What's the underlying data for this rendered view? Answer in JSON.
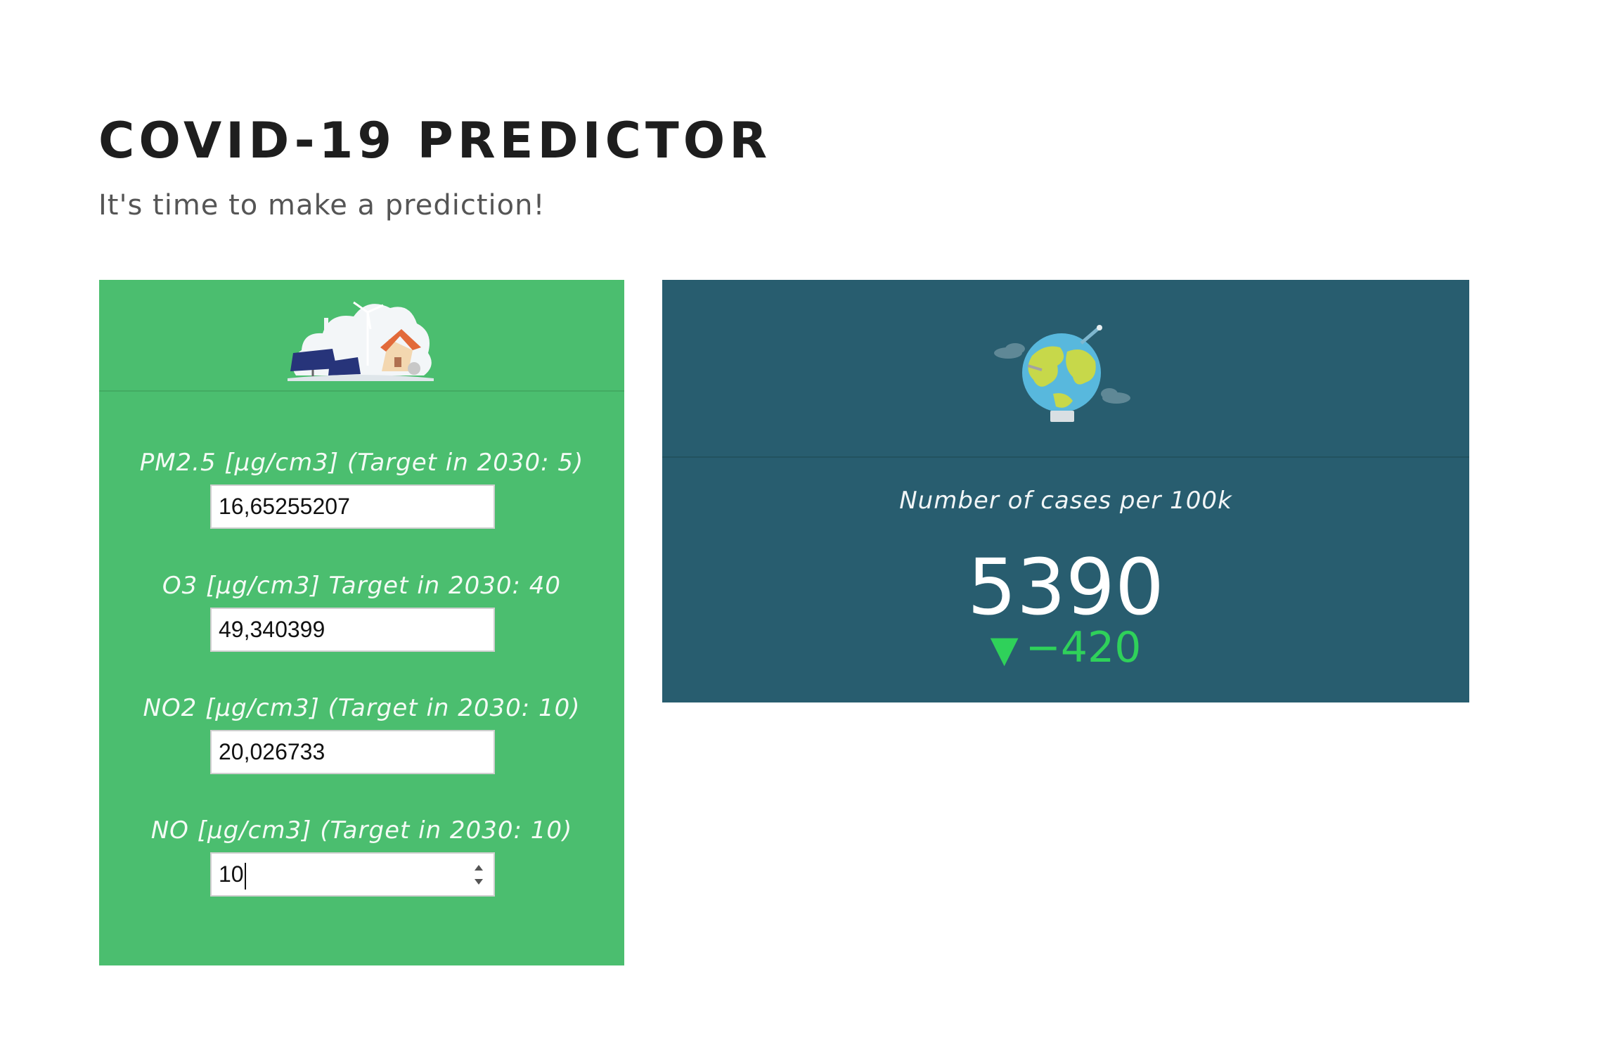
{
  "header": {
    "title": "COVID-19 PREDICTOR",
    "subtitle": "It's time to make a prediction!"
  },
  "inputs": [
    {
      "label": "PM2.5 [µg/cm3] (Target in 2030: 5)",
      "value": "16,65255207"
    },
    {
      "label": "O3 [µg/cm3] Target in 2030: 40",
      "value": "49,340399"
    },
    {
      "label": "NO2 [µg/cm3] (Target in 2030: 10)",
      "value": "20,026733"
    },
    {
      "label": "NO [µg/cm3] (Target in 2030: 10)",
      "value": "10"
    }
  ],
  "result": {
    "label": "Number of cases per 100k",
    "value": "5390",
    "delta_arrow": "▼",
    "delta": "−420"
  },
  "icons": {
    "input_card": "renewable-energy-illustration",
    "result_card": "globe-illustration",
    "delta": "down-arrow-icon"
  },
  "colors": {
    "input_card_bg": "#4bbe6f",
    "result_card_bg": "#285d6f",
    "delta_color": "#2fd15a"
  }
}
